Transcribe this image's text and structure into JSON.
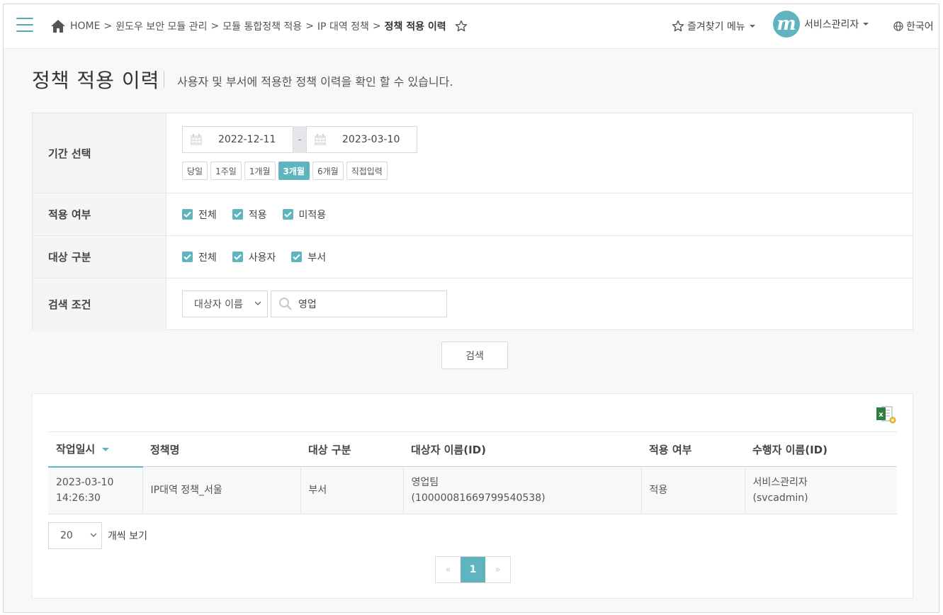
{
  "header": {
    "breadcrumb": [
      "HOME",
      "윈도우 보안 모듈 관리",
      "모듈 통합정책 적용",
      "IP 대역 정책"
    ],
    "breadcrumb_sep": ">",
    "current": "정책 적용 이력",
    "favorites_label": "즐겨찾기 메뉴",
    "user_name": "서비스관리자",
    "avatar_letter": "m",
    "language": "한국어"
  },
  "page": {
    "title": "정책 적용 이력",
    "description": "사용자 및 부서에 적용한 정책 이력을 확인 할 수 있습니다."
  },
  "filters": {
    "period_label": "기간 선택",
    "date_from": "2022-12-11",
    "date_to": "2023-03-10",
    "date_dash": "-",
    "period_buttons": [
      "당일",
      "1주일",
      "1개월",
      "3개월",
      "6개월",
      "직접입력"
    ],
    "period_active": "3개월",
    "apply_label": "적용 여부",
    "apply_options": [
      "전체",
      "적용",
      "미적용"
    ],
    "target_label": "대상 구분",
    "target_options": [
      "전체",
      "사용자",
      "부서"
    ],
    "search_label": "검색 조건",
    "search_field": "대상자 이름",
    "search_value": "영업",
    "search_button": "검색"
  },
  "table": {
    "columns": [
      "작업일시",
      "정책명",
      "대상 구분",
      "대상자 이름(ID)",
      "적용 여부",
      "수행자 이름(ID)"
    ],
    "rows": [
      {
        "date": "2023-03-10",
        "time": "14:26:30",
        "policy": "IP대역 정책_서울",
        "target_type": "부서",
        "target_name": "영업팀",
        "target_id": "(10000081669799540538)",
        "applied": "적용",
        "actor_name": "서비스관리자",
        "actor_id": "(svcadmin)"
      }
    ]
  },
  "pagination": {
    "page_size": "20",
    "page_size_label": "개씩 보기",
    "prev": "«",
    "current_page": "1",
    "next": "»"
  },
  "colors": {
    "accent": "#5fb4bf",
    "label_bg": "#f4f5f7",
    "page_bg": "#f7f8fa"
  },
  "icons": [
    "menu-icon",
    "home-icon",
    "star-icon",
    "globe-icon",
    "calendar-icon",
    "search-icon",
    "check-icon",
    "chevron-down-icon",
    "excel-icon",
    "sort-down-icon"
  ]
}
